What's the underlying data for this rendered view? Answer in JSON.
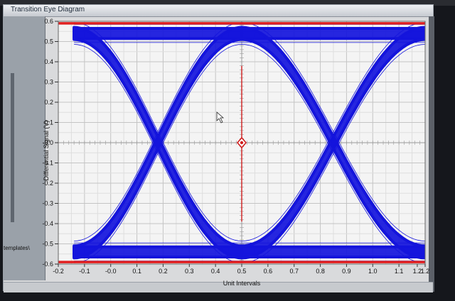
{
  "window": {
    "title": "Transition Eye Diagram"
  },
  "left_panel": {
    "path_text": "templates\\"
  },
  "chart_data": {
    "type": "line",
    "title": "Transition Eye Diagram",
    "xlabel": "Unit Intervals",
    "ylabel": "Differential Signal  (V)",
    "xlim": [
      -0.2,
      1.2
    ],
    "ylim": [
      -0.6,
      0.6
    ],
    "x_ticks": [
      {
        "value": -0.2,
        "label": "-0.2"
      },
      {
        "value": -0.1,
        "label": "-0.1"
      },
      {
        "value": 0.0,
        "label": "-0.0"
      },
      {
        "value": 0.1,
        "label": "0.1"
      },
      {
        "value": 0.2,
        "label": "0.2"
      },
      {
        "value": 0.3,
        "label": "0.3"
      },
      {
        "value": 0.4,
        "label": "0.4"
      },
      {
        "value": 0.5,
        "label": "0.5"
      },
      {
        "value": 0.6,
        "label": "0.6"
      },
      {
        "value": 0.7,
        "label": "0.7"
      },
      {
        "value": 0.8,
        "label": "0.8"
      },
      {
        "value": 0.9,
        "label": "0.9"
      },
      {
        "value": 1.0,
        "label": "1.0"
      },
      {
        "value": 1.1,
        "label": "1.1"
      },
      {
        "value": 1.17,
        "label": "1.2"
      },
      {
        "value": 1.2,
        "label": "1.2"
      }
    ],
    "y_ticks": [
      {
        "value": 0.6,
        "label": "0.6"
      },
      {
        "value": 0.5,
        "label": "0.5"
      },
      {
        "value": 0.4,
        "label": "0.4"
      },
      {
        "value": 0.3,
        "label": "0.3"
      },
      {
        "value": 0.2,
        "label": "0.2"
      },
      {
        "value": 0.1,
        "label": "0.1"
      },
      {
        "value": 0.0,
        "label": "-0.0"
      },
      {
        "value": -0.1,
        "label": "-0.1"
      },
      {
        "value": -0.2,
        "label": "-0.2"
      },
      {
        "value": -0.3,
        "label": "-0.3"
      },
      {
        "value": -0.4,
        "label": "-0.4"
      },
      {
        "value": -0.5,
        "label": "-0.5"
      },
      {
        "value": -0.6,
        "label": "-0.6"
      }
    ],
    "grid": true,
    "series": [
      {
        "role": "high-level",
        "color": "#1414dc",
        "x": [
          -0.14,
          1.2
        ],
        "y": [
          0.54,
          0.54
        ],
        "spread": 0.05
      },
      {
        "role": "low-level",
        "color": "#1414dc",
        "x": [
          -0.14,
          1.2
        ],
        "y": [
          -0.54,
          -0.54
        ],
        "spread": 0.05
      },
      {
        "role": "rising-transition",
        "color": "#1414dc",
        "x": [
          -0.14,
          0.5
        ],
        "y": [
          -0.54,
          0.54
        ],
        "spread": 0.06
      },
      {
        "role": "falling-transition",
        "color": "#1414dc",
        "x": [
          -0.14,
          0.5
        ],
        "y": [
          0.54,
          -0.54
        ],
        "spread": 0.06
      },
      {
        "role": "rising-transition",
        "color": "#1414dc",
        "x": [
          0.5,
          1.2
        ],
        "y": [
          -0.54,
          0.54
        ],
        "spread": 0.06
      },
      {
        "role": "falling-transition",
        "color": "#1414dc",
        "x": [
          0.5,
          1.2
        ],
        "y": [
          0.54,
          -0.54
        ],
        "spread": 0.06
      }
    ],
    "mask_lines": {
      "color": "#e02020",
      "y": [
        0.59,
        -0.59
      ]
    },
    "marker": {
      "color": "#d01e1e",
      "x": 0.5,
      "y_top": 0.38,
      "y_bottom": -0.39
    }
  },
  "colors": {
    "trace": "#1414dc",
    "mask": "#e02020",
    "background": "#f4f4f4",
    "grid": "#c8c8c8"
  }
}
